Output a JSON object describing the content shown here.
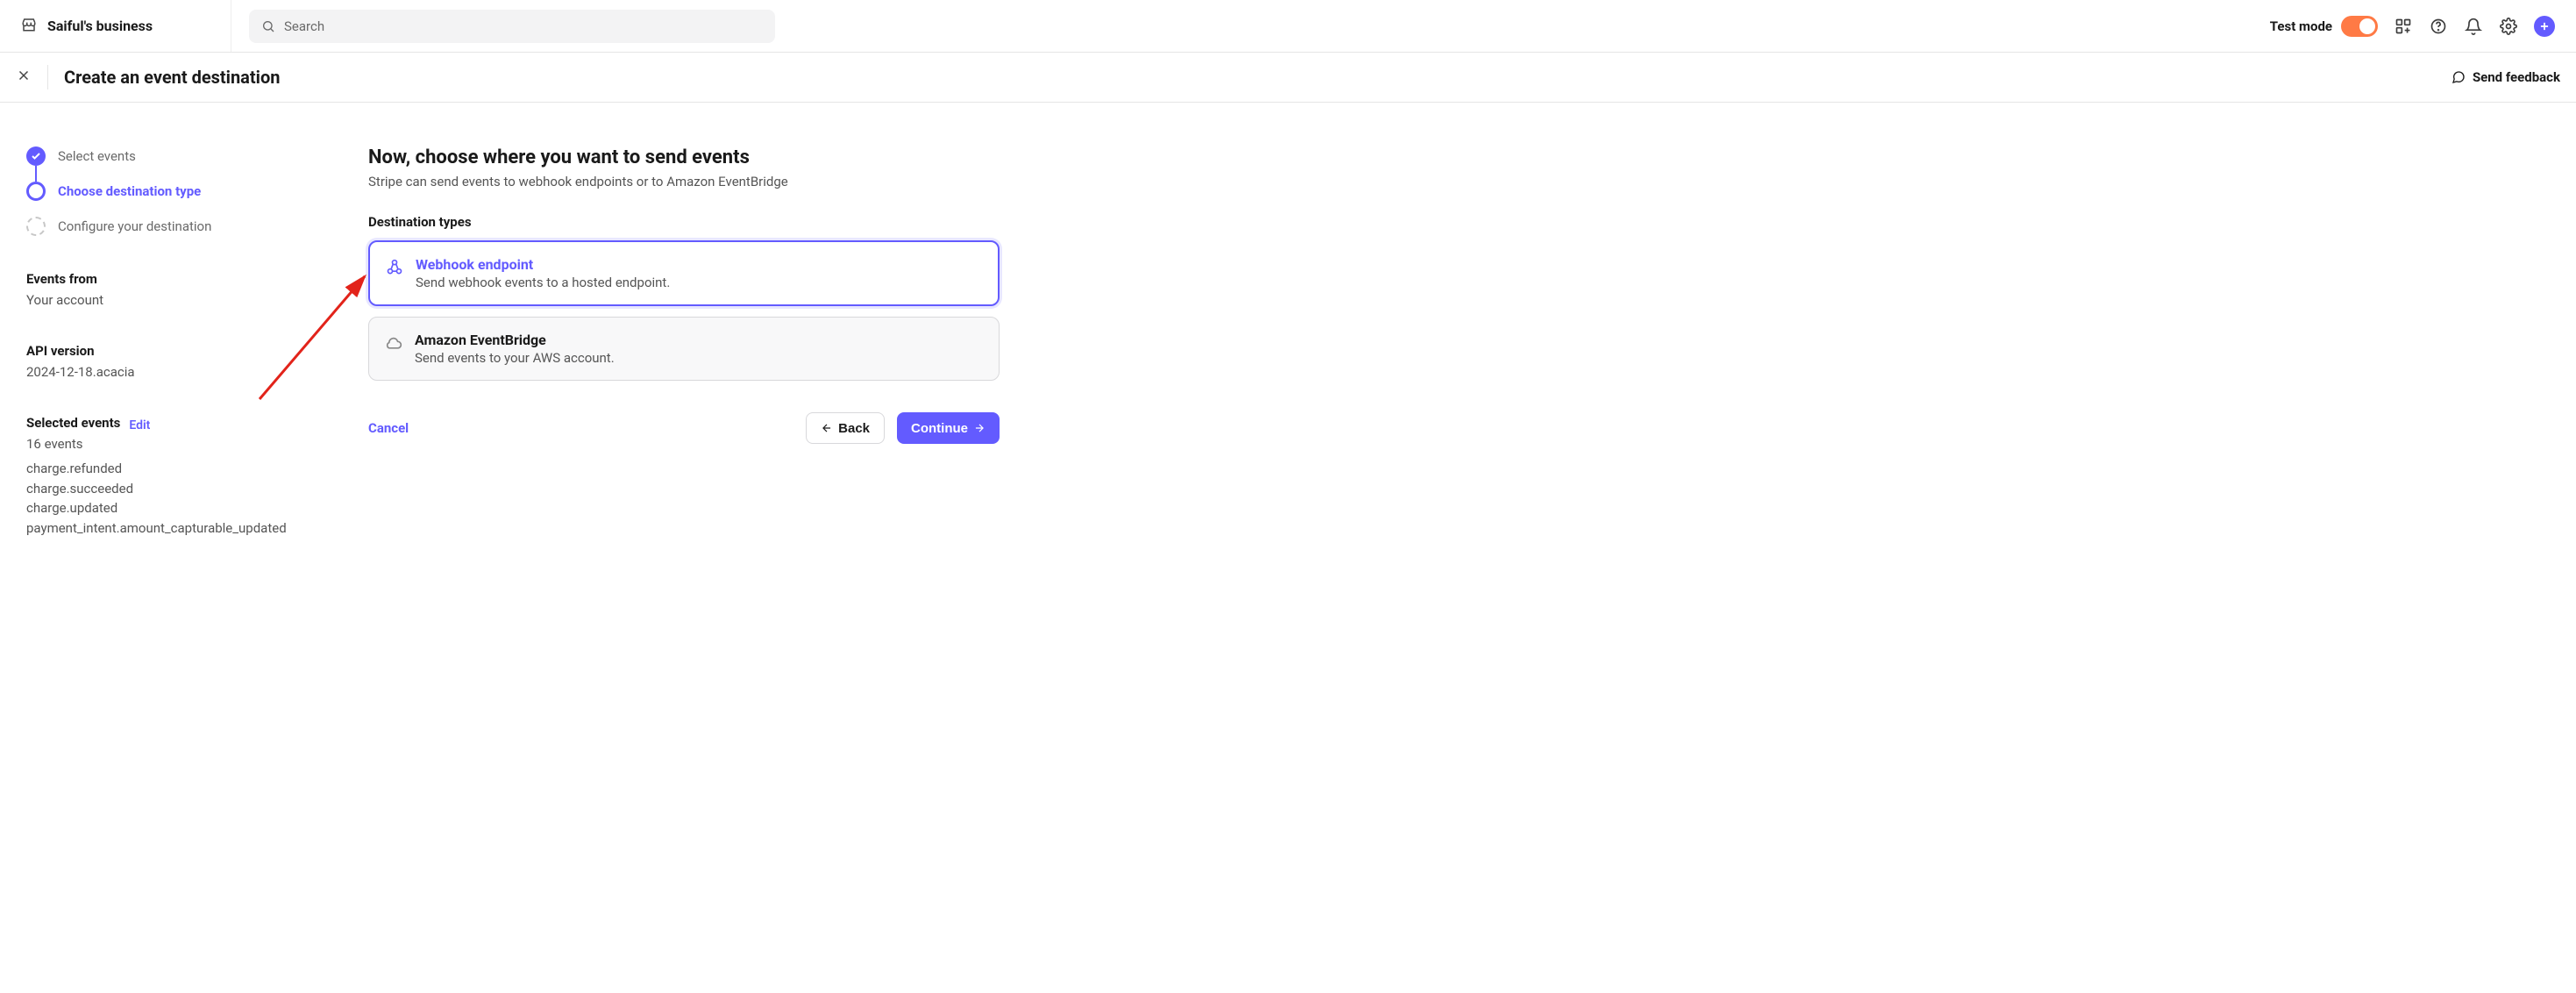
{
  "nav": {
    "business_name": "Saiful's business",
    "search_placeholder": "Search",
    "test_mode_label": "Test mode"
  },
  "subheader": {
    "title": "Create an event destination",
    "send_feedback": "Send feedback"
  },
  "stepper": {
    "step1": "Select events",
    "step2": "Choose destination type",
    "step3": "Configure your destination"
  },
  "sidebar": {
    "events_from_label": "Events from",
    "events_from_value": "Your account",
    "api_version_label": "API version",
    "api_version_value": "2024-12-18.acacia",
    "selected_events_label": "Selected events",
    "edit_label": "Edit",
    "selected_events_count": "16 events",
    "events": [
      "charge.refunded",
      "charge.succeeded",
      "charge.updated",
      "payment_intent.amount_capturable_updated"
    ]
  },
  "content": {
    "heading": "Now, choose where you want to send events",
    "subtitle": "Stripe can send events to webhook endpoints or to Amazon EventBridge",
    "dest_types_label": "Destination types",
    "options": {
      "webhook": {
        "title": "Webhook endpoint",
        "desc": "Send webhook events to a hosted endpoint."
      },
      "eventbridge": {
        "title": "Amazon EventBridge",
        "desc": "Send events to your AWS account."
      }
    }
  },
  "actions": {
    "cancel": "Cancel",
    "back": "Back",
    "continue": "Continue"
  }
}
